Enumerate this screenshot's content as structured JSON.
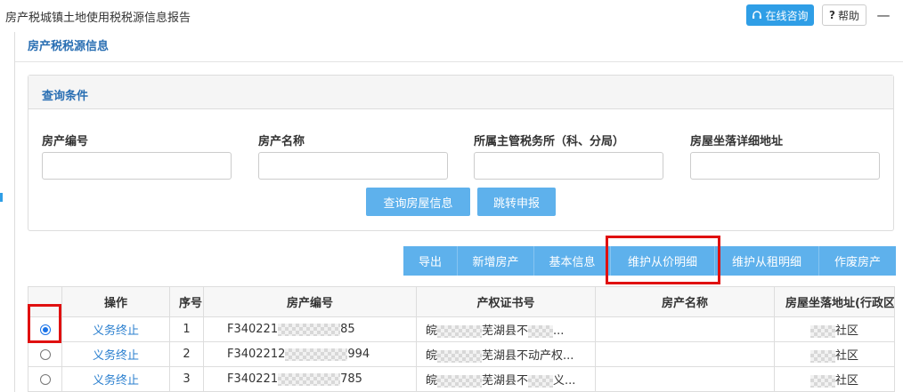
{
  "window": {
    "title": "房产税城镇土地使用税税源信息报告",
    "consult_label": "在线咨询",
    "help_label": "帮助",
    "minimize_glyph": "—"
  },
  "panel": {
    "title": "房产税税源信息"
  },
  "query": {
    "title": "查询条件",
    "fields": [
      {
        "label": "房产编号",
        "value": ""
      },
      {
        "label": "房产名称",
        "value": ""
      },
      {
        "label": "所属主管税务所（科、分局）",
        "value": ""
      },
      {
        "label": "房屋坐落详细地址",
        "value": ""
      }
    ],
    "search_button": "查询房屋信息",
    "jump_button": "跳转申报"
  },
  "toolbar": {
    "buttons": [
      "导出",
      "新增房产",
      "基本信息",
      "维护从价明细",
      "维护从租明细",
      "作废房产"
    ]
  },
  "table": {
    "columns": [
      "",
      "操作",
      "序号",
      "房产编号",
      "产权证书号",
      "房产名称",
      "房屋坐落地址(行政区划"
    ],
    "rows": [
      {
        "selected": true,
        "action": "义务终止",
        "index": "1",
        "code_prefix": "F340221",
        "code_suffix": "85",
        "cert_prefix": "皖",
        "cert_text": "芜湖县不",
        "cert_suffix": "...",
        "name": "",
        "addr_suffix": "社区"
      },
      {
        "selected": false,
        "action": "义务终止",
        "index": "2",
        "code_prefix": "F3402212",
        "code_suffix": "994",
        "cert_prefix": "皖",
        "cert_text": "芜湖县不动产权",
        "cert_suffix": "...",
        "name": "",
        "addr_suffix": "社区"
      },
      {
        "selected": false,
        "action": "义务终止",
        "index": "3",
        "code_prefix": "F340221",
        "code_suffix": "785",
        "cert_prefix": "皖",
        "cert_text": "芜湖县不",
        "cert_suffix": "义...",
        "name": "",
        "addr_suffix": "社区"
      }
    ]
  },
  "colors": {
    "accent": "#2f9ee6",
    "button": "#5eb1ec",
    "highlight": "#e01010",
    "heading": "#2a6fb3"
  }
}
